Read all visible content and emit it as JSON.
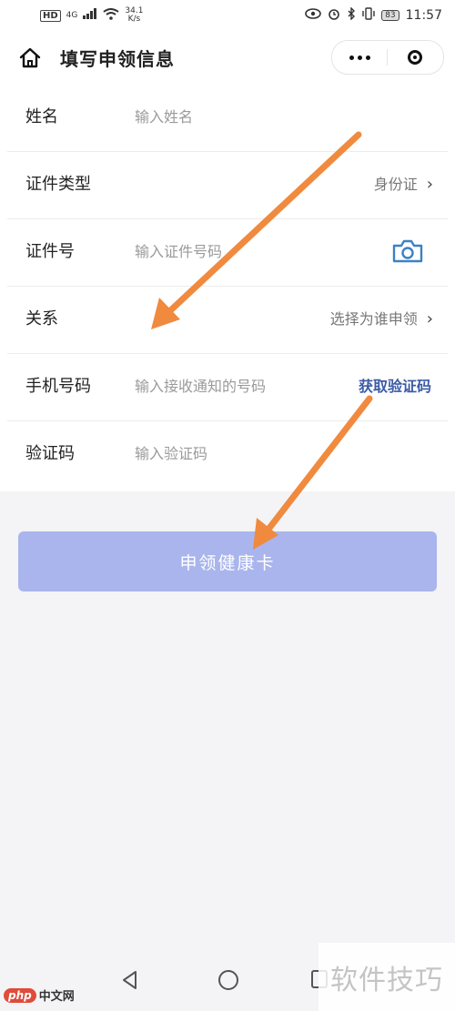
{
  "status_bar": {
    "hd": "HD",
    "network": "4G",
    "speed_value": "34.1",
    "speed_unit": "K/s",
    "battery": "83",
    "time": "11:57"
  },
  "header": {
    "title": "填写申领信息",
    "icons": [
      "home-icon",
      "more-icon",
      "close-circle-icon"
    ]
  },
  "form": {
    "fields": [
      {
        "label": "姓名",
        "placeholder": "输入姓名"
      },
      {
        "label": "证件类型",
        "value": "身份证"
      },
      {
        "label": "证件号",
        "placeholder": "输入证件号码"
      },
      {
        "label": "关系",
        "value": "选择为谁申领"
      },
      {
        "label": "手机号码",
        "placeholder": "输入接收通知的号码",
        "action": "获取验证码"
      },
      {
        "label": "验证码",
        "placeholder": "输入验证码"
      }
    ]
  },
  "submit_label": "申领健康卡",
  "colors": {
    "submit_bg": "#a9b5ec",
    "link": "#3b5aa6",
    "annotation_arrow": "#f08a3e",
    "camera_icon": "#3b82c4"
  },
  "watermarks": {
    "left_logo": "php",
    "left_text": "中文网",
    "right_text": "软件技巧"
  }
}
